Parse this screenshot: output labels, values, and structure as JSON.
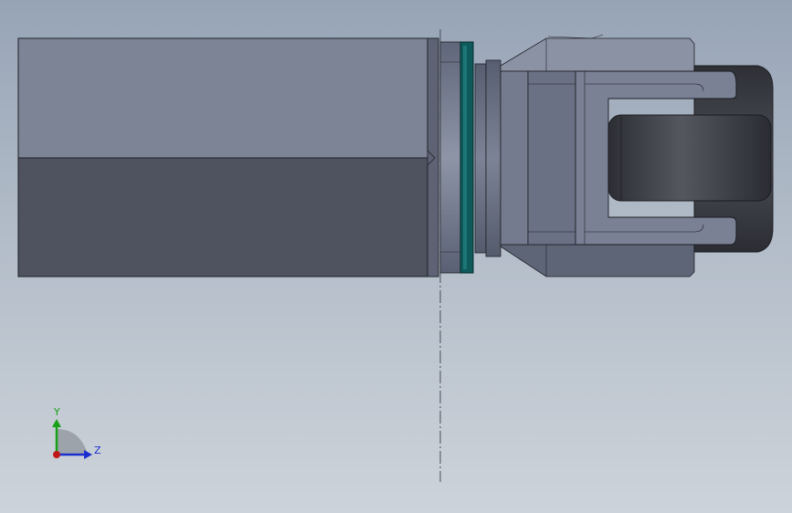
{
  "viewport": {
    "background_top": "#97a4b6",
    "background_bottom": "#cdd3da"
  },
  "model": {
    "parts": [
      "motor-housing",
      "adapter-flange",
      "green-seal-ring",
      "gear-flange",
      "joint-yoke",
      "rubber-roller"
    ],
    "colors": {
      "housing_top": "#7c8496",
      "housing_bottom": "#4f5360",
      "metal": "#6a7184",
      "metal_light": "#8d94a6",
      "seal": "#0e5a5a",
      "roller": "#3e4048"
    }
  },
  "triad": {
    "y_label": "Y",
    "z_label": "Z",
    "y_color": "#18a018",
    "z_color": "#1a2fd0",
    "x_color": "#c01818"
  }
}
